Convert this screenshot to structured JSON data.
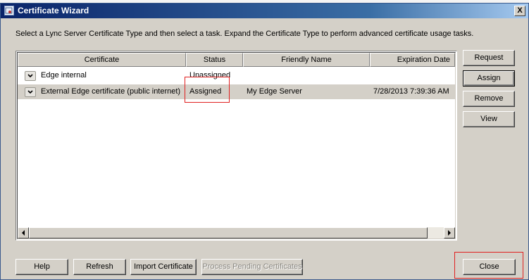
{
  "window": {
    "title": "Certificate Wizard",
    "close_glyph": "X"
  },
  "instruction": "Select a Lync Server Certificate Type and then select a task. Expand the Certificate Type to perform advanced certificate usage tasks.",
  "table": {
    "columns": [
      "Certificate",
      "Status",
      "Friendly Name",
      "Expiration Date"
    ],
    "rows": [
      {
        "certificate": "Edge internal",
        "status": "Unassigned",
        "friendly_name": "",
        "expiration": ""
      },
      {
        "certificate": "External Edge certificate (public internet)",
        "status": "Assigned",
        "friendly_name": "My Edge Server",
        "expiration": "7/28/2013 7:39:36 AM"
      }
    ]
  },
  "side_buttons": {
    "request": "Request",
    "assign": "Assign",
    "remove": "Remove",
    "view": "View"
  },
  "bottom_buttons": {
    "help": "Help",
    "refresh": "Refresh",
    "import": "Import Certificate",
    "process_pending": "Process Pending Certificates",
    "close": "Close"
  },
  "colors": {
    "highlight_box": "#e02020",
    "title_bar": "#0a246a",
    "dialog_bg": "#d4d0c8"
  }
}
